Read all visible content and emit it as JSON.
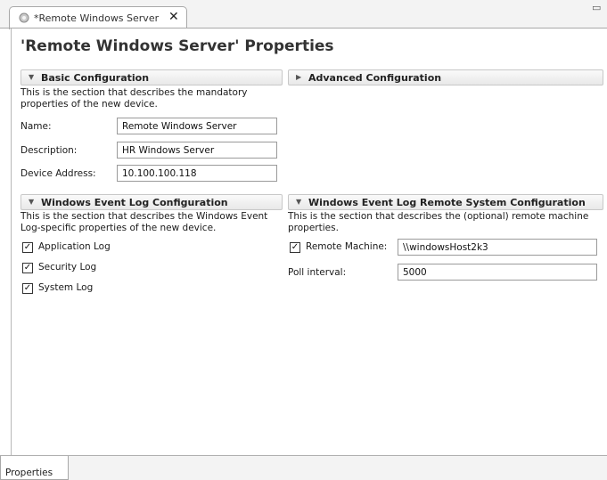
{
  "editor_tab": {
    "label": "*Remote Windows Server",
    "close": "✕"
  },
  "window_controls": {
    "minimize": "▭"
  },
  "page": {
    "title": "'Remote Windows Server' Properties"
  },
  "basic": {
    "title": "Basic Configuration",
    "expanded": true,
    "description": "This is the section that describes the mandatory properties of the new device.",
    "name_label": "Name:",
    "name_value": "Remote Windows Server",
    "description_label": "Description:",
    "description_value": "HR Windows Server",
    "address_label": "Device Address:",
    "address_value": "10.100.100.118"
  },
  "advanced": {
    "title": "Advanced Configuration",
    "expanded": false
  },
  "event_log": {
    "title": "Windows Event Log Configuration",
    "expanded": true,
    "description": "This is the section that describes the Windows Event Log-specific properties of the new device.",
    "checks": [
      {
        "label": "Application Log",
        "checked": true
      },
      {
        "label": "Security Log",
        "checked": true
      },
      {
        "label": "System Log",
        "checked": true
      }
    ]
  },
  "remote": {
    "title": "Windows Event Log Remote System Configuration",
    "expanded": true,
    "description": "This is the section that describes the (optional) remote machine properties.",
    "remote_machine_label": "Remote Machine:",
    "remote_machine_checked": true,
    "remote_machine_value": "\\\\windowsHost2k3",
    "poll_label": "Poll interval:",
    "poll_value": "5000"
  },
  "bottom_tab": {
    "label": "Properties"
  },
  "glyphs": {
    "expanded": "▼",
    "collapsed": "▶",
    "check": "✓"
  }
}
